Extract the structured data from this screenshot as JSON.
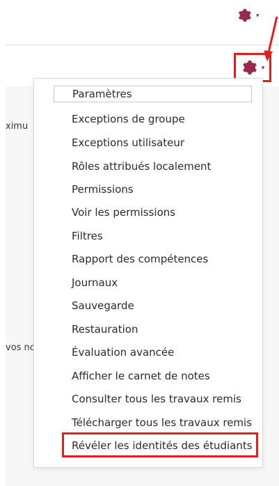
{
  "header": {
    "settings_icon": "gear-icon",
    "dropdown_icon": "chevron-down-icon",
    "caret_glyph": "▾"
  },
  "page": {
    "fragments": [
      "ximu",
      "vos nc"
    ]
  },
  "menu": {
    "items": [
      "Paramètres",
      "Exceptions de groupe",
      "Exceptions utilisateur",
      "Rôles attribués localement",
      "Permissions",
      "Voir les permissions",
      "Filtres",
      "Rapport des compétences",
      "Journaux",
      "Sauvegarde",
      "Restauration",
      "Évaluation avancée",
      "Afficher le carnet de notes",
      "Consulter tous les travaux remis",
      "Télécharger tous les travaux remis",
      "Révéler les identités des étudiants"
    ]
  },
  "colors": {
    "gear": "#9a2a4b",
    "highlight": "#e02020",
    "background": "#f7f7f7"
  }
}
